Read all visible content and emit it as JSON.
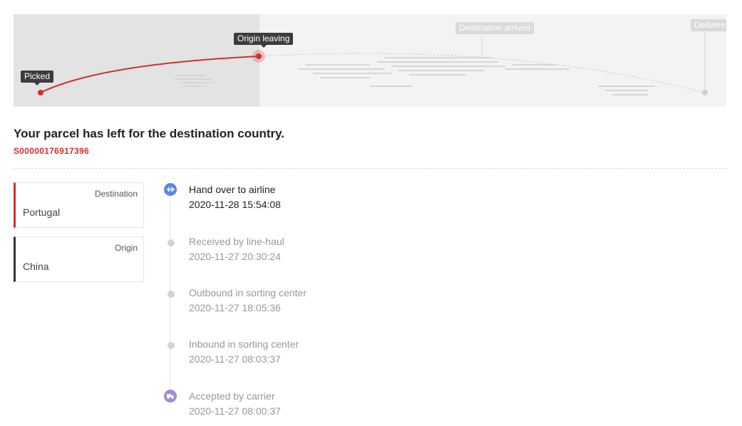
{
  "map": {
    "milestones": [
      {
        "label": "Picked",
        "state": "done"
      },
      {
        "label": "Origin leaving",
        "state": "current"
      },
      {
        "label": "Destination arrived",
        "state": "pending"
      },
      {
        "label": "Delivere",
        "state": "pending"
      }
    ],
    "colors": {
      "progress": "#d0312d",
      "pending": "#c8c8c8",
      "done_bg": "#e3e3e3",
      "pending_bg": "#f3f3f3"
    }
  },
  "status": {
    "headline": "Your parcel has left for the destination country.",
    "tracking_number": "S00000176917396"
  },
  "locations": {
    "destination": {
      "label": "Destination",
      "value": "Portugal"
    },
    "origin": {
      "label": "Origin",
      "value": "China"
    }
  },
  "events": [
    {
      "title": "Hand over to airline",
      "time": "2020-11-28 15:54:08",
      "icon": "airplane-icon"
    },
    {
      "title": "Received by line-haul",
      "time": "2020-11-27 20:30:24",
      "icon": "dot"
    },
    {
      "title": "Outbound in sorting center",
      "time": "2020-11-27 18:05:36",
      "icon": "dot"
    },
    {
      "title": "Inbound in sorting center",
      "time": "2020-11-27 08:03:37",
      "icon": "dot"
    },
    {
      "title": "Accepted by carrier",
      "time": "2020-11-27 08:00:37",
      "icon": "truck-icon"
    }
  ]
}
